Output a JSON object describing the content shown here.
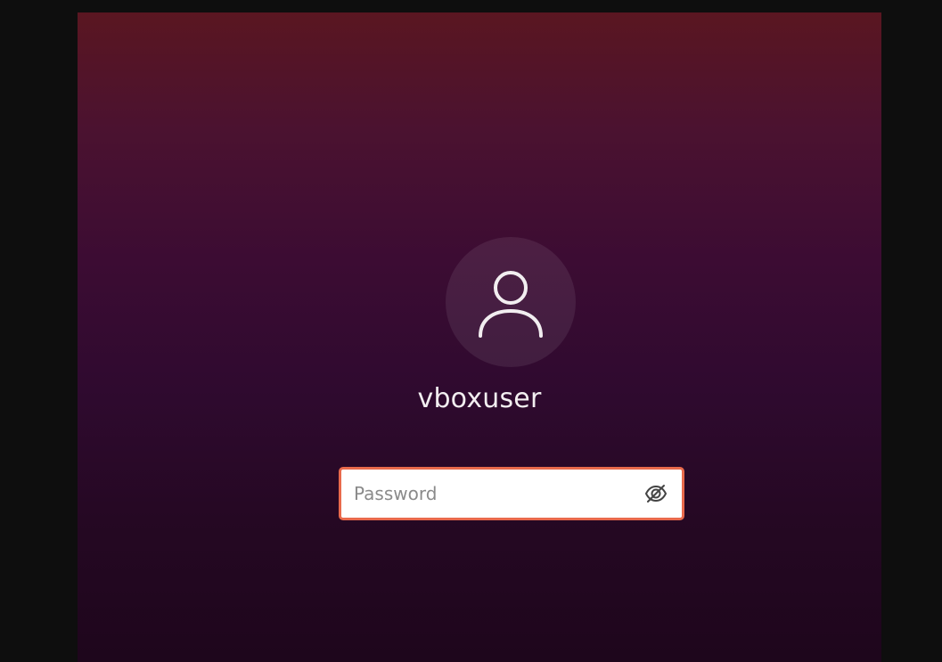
{
  "login": {
    "username": "vboxuser",
    "password_placeholder": "Password",
    "password_value": ""
  },
  "icons": {
    "avatar": "user-avatar-icon",
    "reveal": "eye-off-icon"
  },
  "colors": {
    "background_top": "#5a1621",
    "background_bottom": "#1e061c",
    "focus_border": "#e86a4c",
    "frame": "#0e0e0e"
  }
}
